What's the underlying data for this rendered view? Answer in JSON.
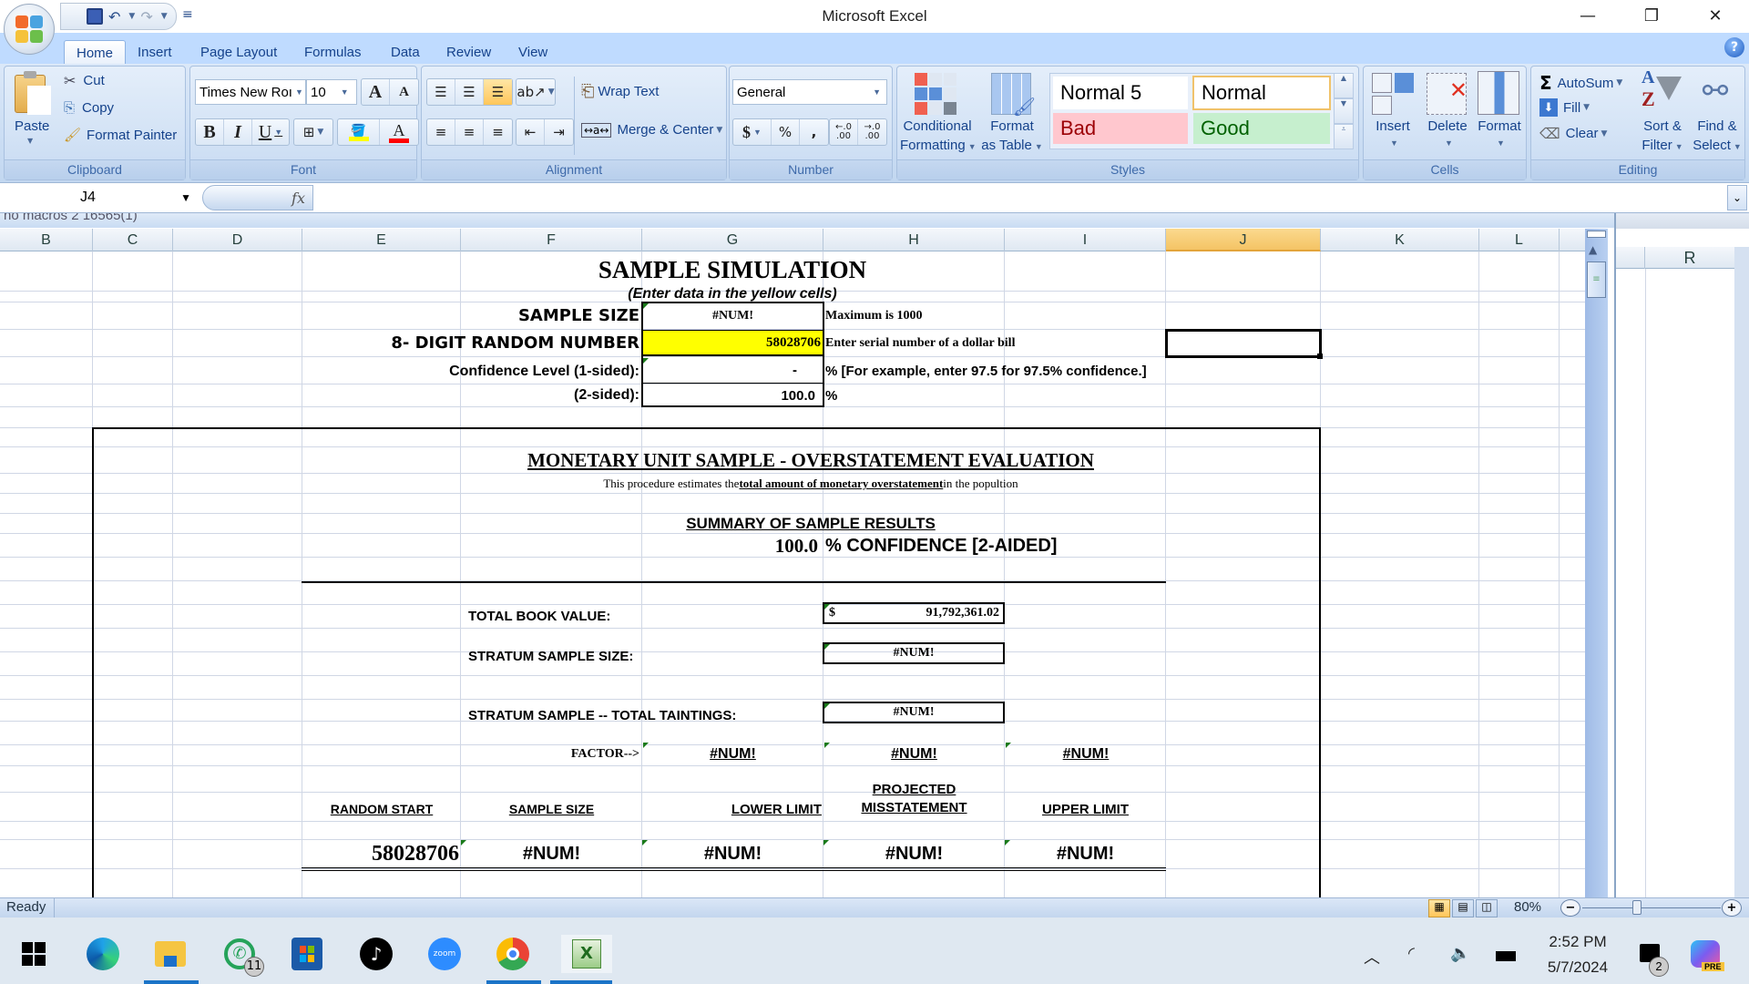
{
  "window": {
    "title": "Microsoft Excel",
    "controls": {
      "minimize": "—",
      "restore": "❐",
      "close": "✕"
    }
  },
  "quick_access": {
    "save": "💾",
    "undo": "↶",
    "redo": "↷",
    "customize": "≡"
  },
  "tabs": [
    "Home",
    "Insert",
    "Page Layout",
    "Formulas",
    "Data",
    "Review",
    "View"
  ],
  "active_tab": "Home",
  "ribbon": {
    "clipboard": {
      "label": "Clipboard",
      "paste": "Paste",
      "cut": "Cut",
      "copy": "Copy",
      "format_painter": "Format Painter"
    },
    "font": {
      "label": "Font",
      "font_name": "Times New Roı",
      "font_size": "10",
      "grow": "A",
      "shrink": "A",
      "bold": "B",
      "italic": "I",
      "underline": "U",
      "fill_color": "#ffff00",
      "font_color": "#ff0000"
    },
    "alignment": {
      "label": "Alignment",
      "wrap_text": "Wrap Text",
      "merge_center": "Merge & Center"
    },
    "number": {
      "label": "Number",
      "format": "General",
      "currency": "$",
      "percent": "%",
      "comma": ",",
      "inc_decimal": ".0 .00",
      "dec_decimal": ".00 .0"
    },
    "styles": {
      "label": "Styles",
      "conditional_formatting": [
        "Conditional",
        "Formatting"
      ],
      "format_as_table": [
        "Format",
        "as Table"
      ],
      "cells": [
        {
          "name": "Normal 5",
          "bg": "#ffffff",
          "fg": "#000000"
        },
        {
          "name": "Normal",
          "bg": "#ffffff",
          "fg": "#000000"
        },
        {
          "name": "Bad",
          "bg": "#ffc7ce",
          "fg": "#9c0006"
        },
        {
          "name": "Good",
          "bg": "#c6efce",
          "fg": "#006100"
        }
      ]
    },
    "cells": {
      "label": "Cells",
      "insert": "Insert",
      "delete": "Delete",
      "format": "Format"
    },
    "editing": {
      "label": "Editing",
      "autosum": "AutoSum",
      "fill": "Fill",
      "clear": "Clear",
      "sort_filter": [
        "Sort &",
        "Filter"
      ],
      "find_select": [
        "Find &",
        "Select"
      ]
    }
  },
  "formula_bar": {
    "name_box": "J4",
    "fx": "fx",
    "formula": ""
  },
  "workbook_name": "no macros 2 16565(1)",
  "columns": [
    "B",
    "C",
    "D",
    "E",
    "F",
    "G",
    "H",
    "I",
    "J",
    "K",
    "L"
  ],
  "selected_column": "J",
  "right_pane_column": "R",
  "sheet": {
    "title": "SAMPLE SIMULATION",
    "subtitle": "(Enter data in the yellow cells)",
    "sample_size_label": "SAMPLE SIZE",
    "sample_size_value": "#NUM!",
    "sample_size_note": "Maximum is 1000",
    "random_number_label": "8- DIGIT RANDOM NUMBER",
    "random_number_value": "58028706",
    "random_number_note": "Enter serial number of a dollar bill",
    "conf1_label": "Confidence Level (1-sided):",
    "conf1_value": "-",
    "conf1_note": "% [For example, enter 97.5 for 97.5% confidence.]",
    "conf2_label": "(2-sided):",
    "conf2_value": "100.0",
    "conf2_note": "%",
    "section_title": "MONETARY UNIT SAMPLE - OVERSTATEMENT EVALUATION",
    "desc_pre": "This procedure estimates the ",
    "desc_bold": "total amount of monetary overstatement",
    "desc_post": " in the popultion",
    "summary_title": "SUMMARY OF SAMPLE  RESULTS",
    "summary_conf_value": "100.0",
    "summary_conf_label": "% CONFIDENCE [2-AIDED]",
    "book_value_label": "TOTAL  BOOK VALUE:",
    "book_value_currency": "$",
    "book_value": "91,792,361.02",
    "stratum_size_label": "STRATUM SAMPLE SIZE:",
    "stratum_size_value": "#NUM!",
    "taintings_label": "STRATUM SAMPLE -- TOTAL TAINTINGS:",
    "taintings_value": "#NUM!",
    "factor_label": "FACTOR-->",
    "factors": [
      "#NUM!",
      "#NUM!",
      "#NUM!"
    ],
    "result_headers": [
      "RANDOM START",
      "SAMPLE SIZE",
      "LOWER LIMIT",
      "PROJECTED",
      "MISSTATEMENT",
      "UPPER LIMIT"
    ],
    "result_values": [
      "58028706",
      "#NUM!",
      "#NUM!",
      "#NUM!",
      "#NUM!"
    ]
  },
  "status": {
    "text": "Ready",
    "zoom": "80%"
  },
  "taskbar": {
    "apps": [
      "Start",
      "Edge",
      "File Explorer",
      "WhatsApp",
      "Microsoft Store",
      "TikTok",
      "Zoom",
      "Chrome",
      "Excel"
    ],
    "whatsapp_badge": "11",
    "time": "2:52 PM",
    "date": "5/7/2024",
    "notification_badge": "2",
    "copilot_badge": "PRE"
  }
}
